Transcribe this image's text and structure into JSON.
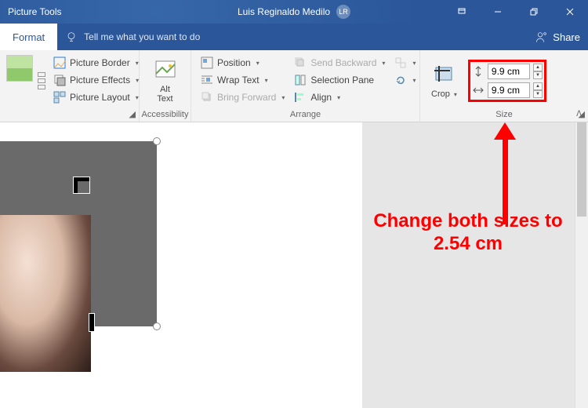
{
  "titlebar": {
    "context_label": "Picture Tools",
    "user_name": "Luis Reginaldo Medilo",
    "user_initials": "LR"
  },
  "tabs": {
    "format": "Format",
    "tellme_placeholder": "Tell me what you want to do",
    "share": "Share"
  },
  "ribbon": {
    "picture_styles": {
      "border": "Picture Border",
      "effects": "Picture Effects",
      "layout": "Picture Layout"
    },
    "accessibility": {
      "alt_text": "Alt\nText",
      "group_label": "Accessibility"
    },
    "arrange": {
      "position": "Position",
      "wrap_text": "Wrap Text",
      "bring_forward": "Bring Forward",
      "send_backward": "Send Backward",
      "selection_pane": "Selection Pane",
      "align": "Align",
      "group_label": "Arrange"
    },
    "size": {
      "crop": "Crop",
      "height_value": "9.9 cm",
      "width_value": "9.9 cm",
      "group_label": "Size"
    }
  },
  "annotation": {
    "text": "Change both sizes to 2.54 cm"
  }
}
